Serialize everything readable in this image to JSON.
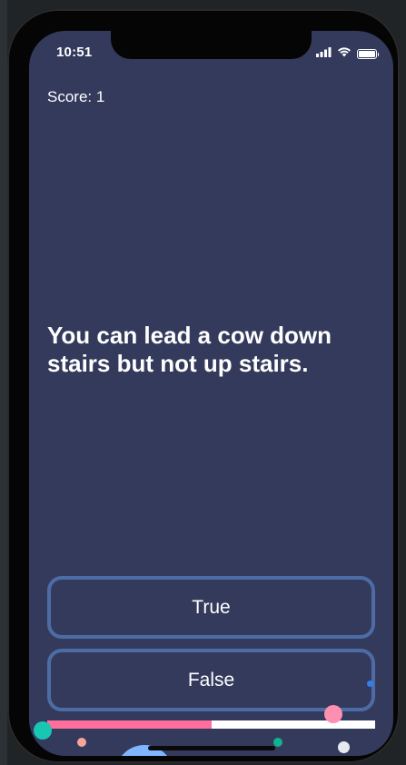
{
  "status_bar": {
    "time": "10:51",
    "icons": [
      "signal-icon",
      "wifi-icon",
      "battery-icon"
    ]
  },
  "game": {
    "score_label": "Score: 1",
    "question": "You can lead a cow down stairs but not up stairs.",
    "answers": {
      "true_label": "True",
      "false_label": "False"
    },
    "progress_fraction": 0.5
  },
  "colors": {
    "background": "#343a5c",
    "button_border": "#4d6ca6",
    "progress_fill": "#ff6f9c",
    "progress_track": "#ffffff",
    "confetti": [
      "#19c6b4",
      "#ff8fb1",
      "#2f80ed",
      "#f7a59b",
      "#0fb38f",
      "#e6e9f0",
      "#7fb6ff",
      "#ff4d4d"
    ]
  }
}
